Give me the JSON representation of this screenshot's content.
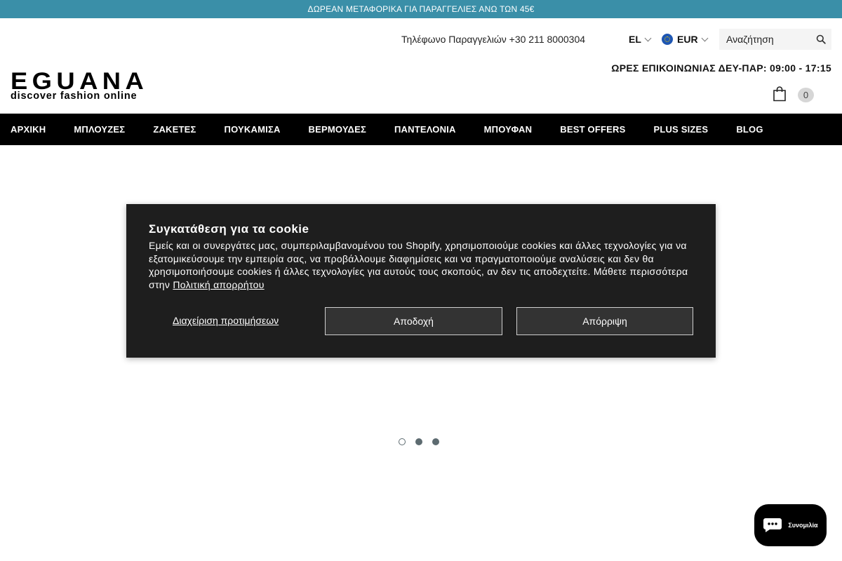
{
  "promo_bar": {
    "text": "ΔΩΡΕΑΝ ΜΕΤΑΦΟΡΙΚΑ ΓΙΑ ΠΑΡΑΓΓΕΛΙΕΣ ΑΝΩ ΤΩΝ 45€"
  },
  "header": {
    "phone": "Τηλέφωνο Παραγγελιών +30 211 8000304",
    "language": "EL",
    "currency": "EUR",
    "search_placeholder": "Αναζήτηση",
    "hours": "ΩΡΕΣ ΕΠΙΚΟΙΝΩΝΙΑΣ ΔΕΥ-ΠΑΡ: 09:00 - 17:15",
    "logo_main": "EGUANA",
    "logo_sub": "discover fashion online",
    "cart_count": "0"
  },
  "nav": {
    "items": [
      {
        "label": "ΑΡΧΙΚΗ"
      },
      {
        "label": "ΜΠΛΟΥΖΕΣ"
      },
      {
        "label": "ΖΑΚΕΤΕΣ"
      },
      {
        "label": "ΠΟΥΚΑΜΙΣΑ"
      },
      {
        "label": "ΒΕΡΜΟΥΔΕΣ"
      },
      {
        "label": "ΠΑΝΤΕΛΟΝΙΑ"
      },
      {
        "label": "ΜΠΟΥΦΑΝ"
      },
      {
        "label": "BEST OFFERS"
      },
      {
        "label": "PLUS SIZES"
      },
      {
        "label": "BLOG"
      }
    ]
  },
  "slider": {
    "slide_count": 3,
    "active_index": 0
  },
  "cookie_banner": {
    "title": "Συγκατάθεση για τα cookie",
    "body": "Εμείς και οι συνεργάτες μας, συμπεριλαμβανομένου του Shopify, χρησιμοποιούμε cookies και άλλες τεχνολογίες για να εξατομικεύσουμε την εμπειρία σας, να προβάλλουμε διαφημίσεις και να πραγματοποιούμε αναλύσεις και δεν θα χρησιμοποιήσουμε cookies ή άλλες τεχνολογίες για αυτούς τους σκοπούς, αν δεν τις αποδεχτείτε. Μάθετε περισσότερα στην ",
    "privacy_link": "Πολιτική απορρήτου",
    "preferences": "Διαχείριση προτιμήσεων",
    "accept": "Αποδοχή",
    "reject": "Απόρριψη"
  },
  "chat": {
    "label": "Συνομιλία"
  },
  "colors": {
    "promo_bar": "#3a8fa8",
    "nav_bg": "#000000",
    "cookie_bg": "#1e1e1e",
    "button_bg": "#333333"
  }
}
